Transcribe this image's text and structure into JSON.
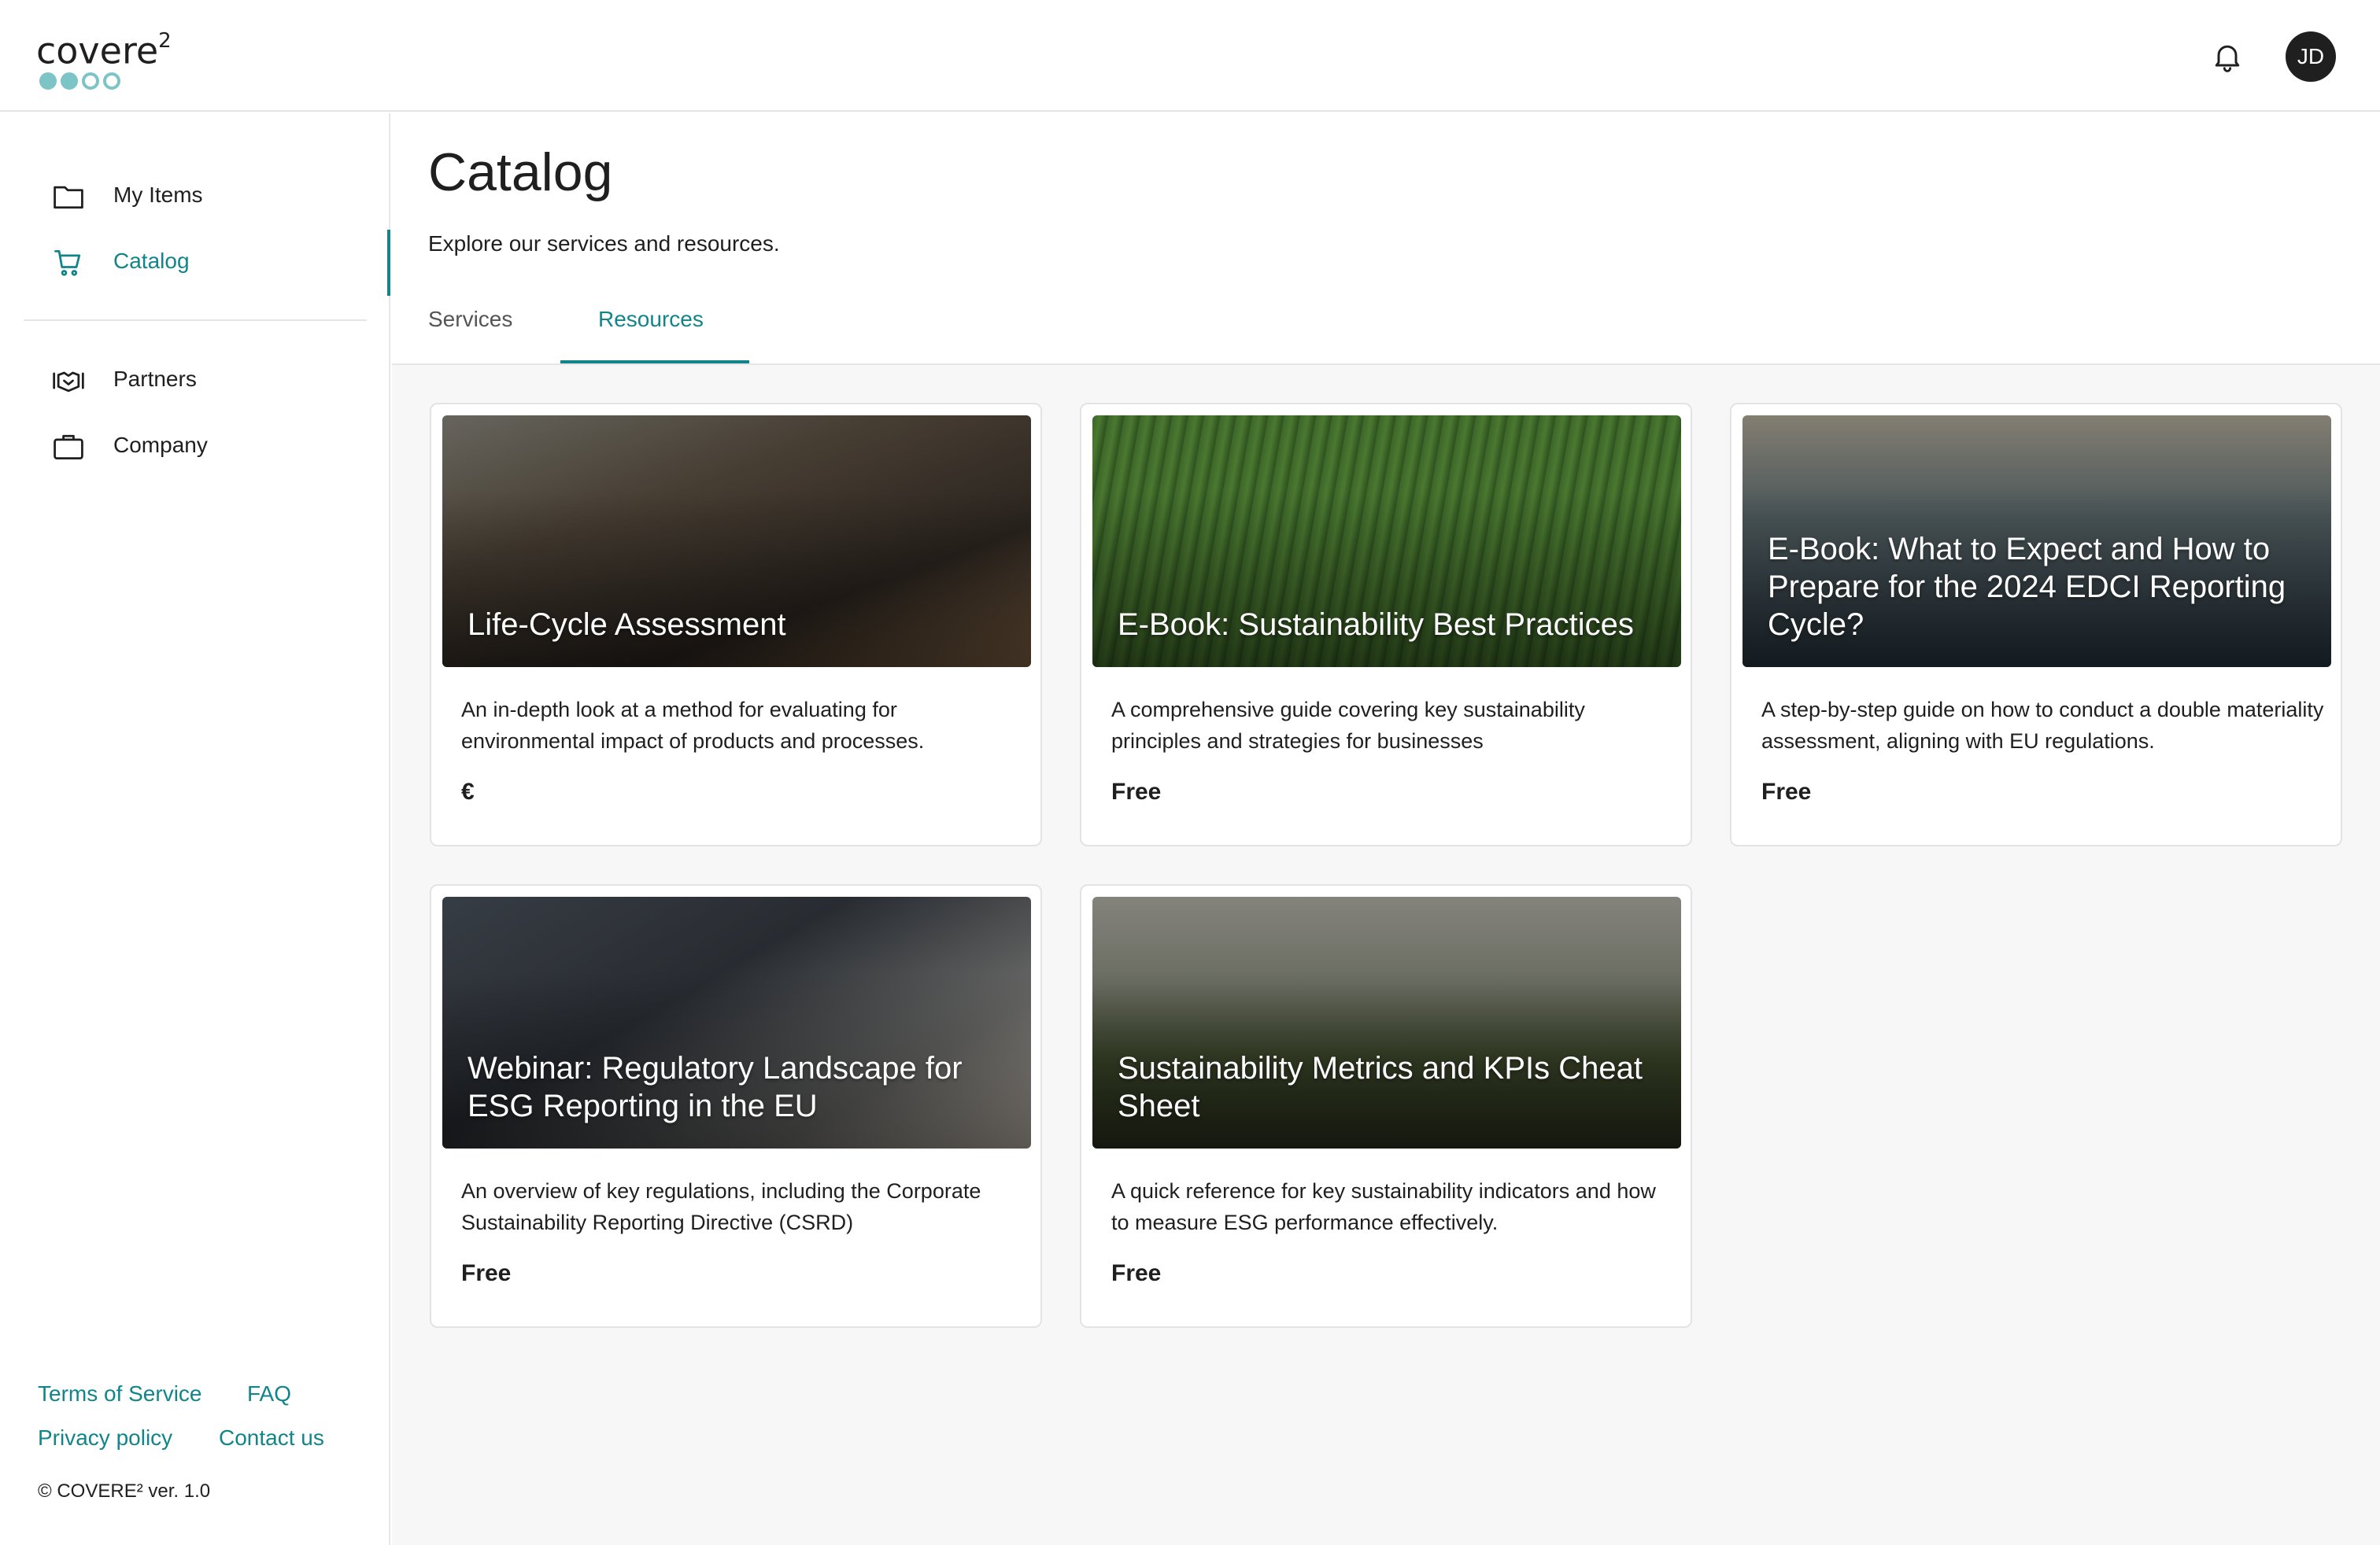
{
  "app": {
    "logo_text": "covere",
    "logo_sup": "2",
    "user_initials": "JD"
  },
  "sidebar": {
    "items": [
      {
        "label": "My Items",
        "icon": "folder-icon",
        "active": false
      },
      {
        "label": "Catalog",
        "icon": "cart-icon",
        "active": true
      },
      {
        "label": "Partners",
        "icon": "handshake-icon",
        "active": false
      },
      {
        "label": "Company",
        "icon": "briefcase-icon",
        "active": false
      }
    ],
    "footer": {
      "terms": "Terms of Service",
      "faq": "FAQ",
      "privacy": "Privacy policy",
      "contact": "Contact us",
      "copyright": "© COVERE² ver. 1.0"
    }
  },
  "page": {
    "title": "Catalog",
    "subtitle": "Explore our services and resources.",
    "tabs": [
      {
        "label": "Services",
        "active": false
      },
      {
        "label": "Resources",
        "active": true
      }
    ]
  },
  "cards": [
    {
      "title": "Life-Cycle Assessment",
      "description": "An in-depth look at a method for evaluating for environmental impact of products and processes.",
      "price": "€"
    },
    {
      "title": "E-Book: Sustainability Best Practices",
      "description": "A comprehensive guide covering key sustainability principles and strategies for businesses",
      "price": "Free"
    },
    {
      "title": "E-Book: What to Expect and How to Prepare for the 2024 EDCI Reporting Cycle?",
      "description": "A step-by-step guide on how to conduct a double materiality assessment, aligning with EU regulations.",
      "price": "Free"
    },
    {
      "title": "Webinar: Regulatory Landscape for ESG Reporting in the EU",
      "description": "An overview of key regulations, including the Corporate Sustainability Reporting Directive (CSRD)",
      "price": "Free"
    },
    {
      "title": "Sustainability Metrics and KPIs Cheat Sheet",
      "description": "A quick reference for key sustainability indicators and how to measure ESG performance effectively.",
      "price": "Free"
    }
  ],
  "colors": {
    "accent": "#12858a",
    "logo_dots": "#7cc4c6",
    "text": "#1f1f1f"
  }
}
